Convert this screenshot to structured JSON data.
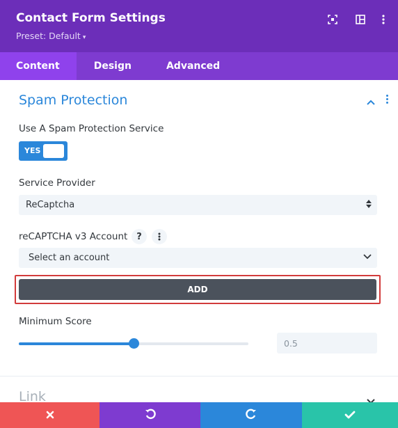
{
  "header": {
    "title": "Contact Form Settings",
    "preset": "Preset: Default",
    "preset_caret": "▾",
    "icons": [
      "focus-icon",
      "split-view-icon",
      "more-vertical-icon"
    ]
  },
  "tabs": [
    {
      "label": "Content",
      "active": true
    },
    {
      "label": "Design",
      "active": false
    },
    {
      "label": "Advanced",
      "active": false
    }
  ],
  "section": {
    "title": "Spam Protection",
    "spam_label": "Use A Spam Protection Service",
    "toggle_text": "YES",
    "provider_label": "Service Provider",
    "provider_value": "ReCaptcha",
    "account_label": "reCAPTCHA v3 Account",
    "help_icon_text": "?",
    "account_value": "Select an account",
    "add_label": "ADD",
    "min_score_label": "Minimum Score",
    "min_score_value": "0.5",
    "slider_fraction": 0.5
  },
  "collapsed_section": {
    "title": "Link"
  },
  "footer": [
    {
      "name": "cancel-button",
      "icon": "close-icon",
      "color": "#ef5555"
    },
    {
      "name": "undo-button",
      "icon": "undo-icon",
      "color": "#7e3bd0"
    },
    {
      "name": "redo-button",
      "icon": "redo-icon",
      "color": "#2b87da"
    },
    {
      "name": "save-button",
      "icon": "check-icon",
      "color": "#29c4a9"
    }
  ],
  "colors": {
    "header": "#6c2eb9",
    "tabs": "#7e3bd0",
    "active_tab": "#8f42ec",
    "accent": "#2b87da",
    "highlight_border": "#d23b3b",
    "add_button": "#4b525c"
  }
}
